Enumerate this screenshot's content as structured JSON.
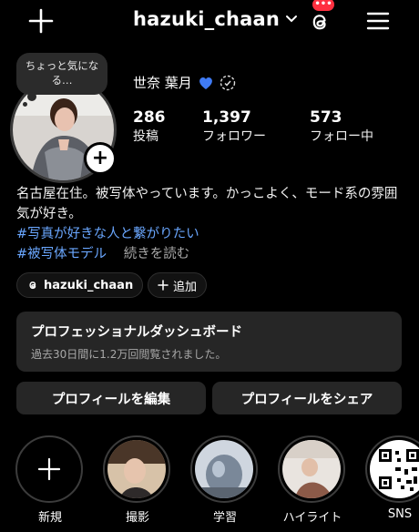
{
  "header": {
    "username": "hazuki_chaan",
    "threads_badge": "•••"
  },
  "note": {
    "text": "ちょっと気になる…"
  },
  "profile": {
    "display_name": "世奈 葉月",
    "stats": [
      {
        "value": "286",
        "label": "投稿"
      },
      {
        "value": "1,397",
        "label": "フォロワー"
      },
      {
        "value": "573",
        "label": "フォロー中"
      }
    ],
    "bio_line1": "名古屋在住。被写体やっています。かっこよく、モード系の雰囲気が好き。",
    "hashtag1": "#写真が好きな人と繋がりたい",
    "hashtag2": "#被写体モデル",
    "more": "続きを読む"
  },
  "chips": {
    "threads_handle": "hazuki_chaan",
    "add_label": "追加"
  },
  "dashboard": {
    "title": "プロフェッショナルダッシュボード",
    "subtitle": "過去30日間に1.2万回閲覧されました。"
  },
  "buttons": {
    "edit": "プロフィールを編集",
    "share": "プロフィールをシェア"
  },
  "highlights": [
    {
      "label": "新規"
    },
    {
      "label": "撮影"
    },
    {
      "label": "学習"
    },
    {
      "label": "ハイライト"
    },
    {
      "label": "SNS"
    }
  ],
  "colors": {
    "background": "#000000",
    "hashtag": "#6aa7ff",
    "badge": "#ff3040",
    "card": "#262626"
  }
}
